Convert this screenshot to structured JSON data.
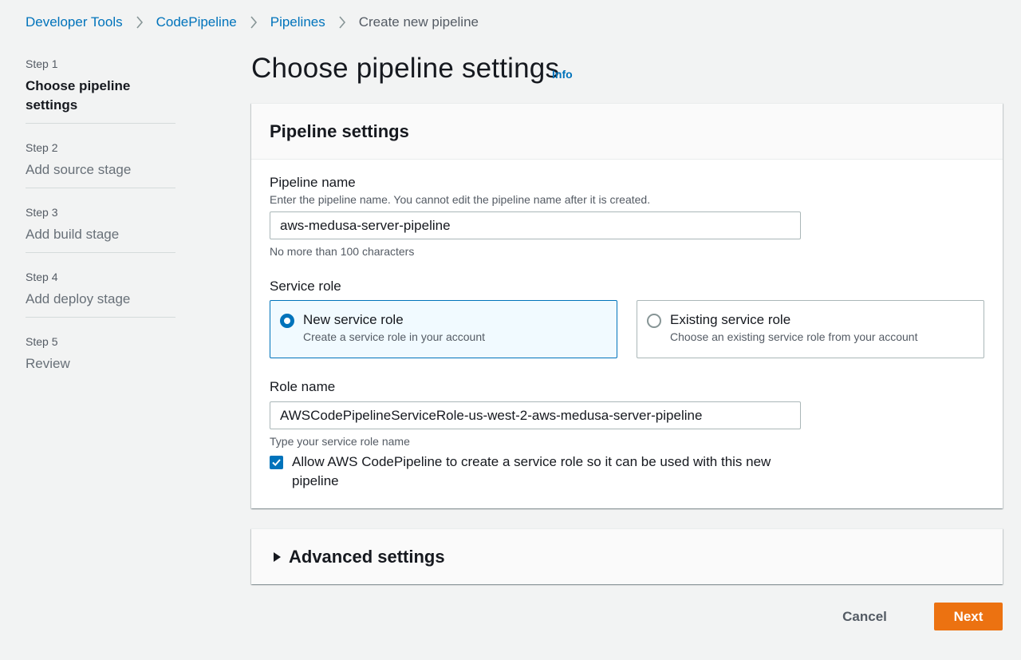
{
  "breadcrumb": {
    "items": [
      "Developer Tools",
      "CodePipeline",
      "Pipelines"
    ],
    "current": "Create new pipeline"
  },
  "steps": [
    {
      "number": "Step 1",
      "label": "Choose pipeline settings",
      "active": true
    },
    {
      "number": "Step 2",
      "label": "Add source stage",
      "active": false
    },
    {
      "number": "Step 3",
      "label": "Add build stage",
      "active": false
    },
    {
      "number": "Step 4",
      "label": "Add deploy stage",
      "active": false
    },
    {
      "number": "Step 5",
      "label": "Review",
      "active": false
    }
  ],
  "header": {
    "title": "Choose pipeline settings",
    "info": "Info"
  },
  "pipeline_settings": {
    "title": "Pipeline settings",
    "pipeline_name": {
      "label": "Pipeline name",
      "description": "Enter the pipeline name. You cannot edit the pipeline name after it is created.",
      "value": "aws-medusa-server-pipeline",
      "constraint": "No more than 100 characters"
    },
    "service_role": {
      "label": "Service role",
      "options": [
        {
          "title": "New service role",
          "description": "Create a service role in your account",
          "selected": true
        },
        {
          "title": "Existing service role",
          "description": "Choose an existing service role from your account",
          "selected": false
        }
      ]
    },
    "role_name": {
      "label": "Role name",
      "value": "AWSCodePipelineServiceRole-us-west-2-aws-medusa-server-pipeline",
      "hint": "Type your service role name"
    },
    "allow_checkbox": {
      "label": "Allow AWS CodePipeline to create a service role so it can be used with this new pipeline",
      "checked": true
    }
  },
  "advanced": {
    "title": "Advanced settings"
  },
  "footer": {
    "cancel": "Cancel",
    "next": "Next"
  },
  "colors": {
    "link": "#0073bb",
    "primary_button": "#ec7211",
    "background": "#f2f3f3"
  }
}
